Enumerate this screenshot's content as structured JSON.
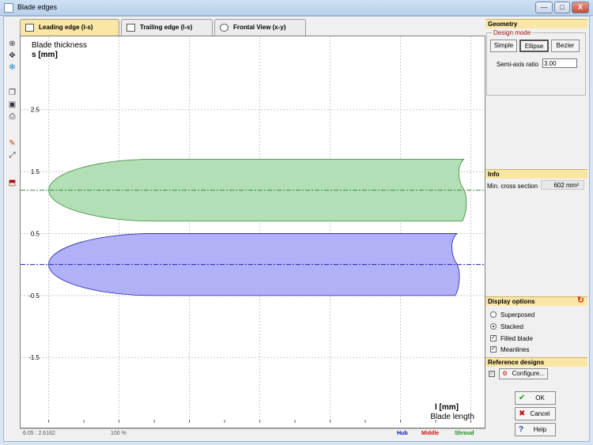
{
  "window": {
    "title": "Blade edges",
    "min_label": "—",
    "max_label": "□",
    "close_label": "X"
  },
  "tabs": [
    {
      "label": "Leading edge (l-s)",
      "active": true
    },
    {
      "label": "Trailing edge (l-s)",
      "active": false
    },
    {
      "label": "Frontal View (x-y)",
      "active": false
    }
  ],
  "toolbar": {
    "icons": [
      "zoom-icon",
      "pan-icon",
      "snowflake-icon",
      "copy-icon",
      "save-icon",
      "print-icon",
      "paint-icon",
      "measure-icon",
      "export-icon"
    ]
  },
  "chart_data": {
    "type": "area",
    "title": "Blade thickness",
    "ylabel": "s [mm]",
    "xlabel": "l [mm]",
    "xlabel2": "Blade length",
    "xlim": [
      -0.4,
      6.05
    ],
    "ylim": [
      -2.25,
      3.3
    ],
    "xticks": [
      "0",
      "1",
      "2",
      "3",
      "4",
      "5",
      "6"
    ],
    "yticks": [
      "2.5",
      "1.5",
      "0.5",
      "-0.5",
      "-1.5"
    ],
    "grid": true,
    "series": [
      {
        "name": "Middle",
        "center": 1.2,
        "half_thickness": 0.5,
        "le_start": 0.0,
        "le_semi_axis": 1.5,
        "end": 5.9,
        "fill": "#b2dfb5",
        "line": "#3e8a3e"
      },
      {
        "name": "Hub",
        "center": 0.0,
        "half_thickness": 0.5,
        "le_start": 0.0,
        "le_semi_axis": 1.5,
        "end": 5.8,
        "fill": "#b1b1f7",
        "line": "#2020b0"
      }
    ]
  },
  "status": {
    "coords": "6.05 : 2.6162",
    "zoom": "100 %",
    "legend": [
      {
        "label": "Hub",
        "color": "#1010c0"
      },
      {
        "label": "Middle",
        "color": "#d01010"
      },
      {
        "label": "Shroud",
        "color": "#1a8a1a"
      }
    ]
  },
  "geometry": {
    "header": "Geometry",
    "design_mode_label": "Design mode",
    "modes": [
      "Simple",
      "Ellipse",
      "Bezier"
    ],
    "active_mode": "Ellipse",
    "semi_axis_label": "Semi-axis ratio",
    "semi_axis_value": "3.00"
  },
  "info": {
    "header": "Info",
    "min_cross_label": "Min. cross section",
    "min_cross_value": "602 mm²"
  },
  "display": {
    "header": "Display options",
    "options": [
      {
        "label": "Superposed",
        "type": "radio",
        "checked": false
      },
      {
        "label": "Stacked",
        "type": "radio",
        "checked": true
      },
      {
        "label": "Filled blade",
        "type": "checkbox",
        "checked": true
      },
      {
        "label": "Meanlines",
        "type": "checkbox",
        "checked": true
      }
    ]
  },
  "reference": {
    "header": "Reference designs",
    "configure_label": "Configure..."
  },
  "actions": {
    "ok": "OK",
    "cancel": "Cancel",
    "help": "Help"
  },
  "colors": {
    "header_bg": "#fbe7a5",
    "accent_red": "#c02010"
  }
}
